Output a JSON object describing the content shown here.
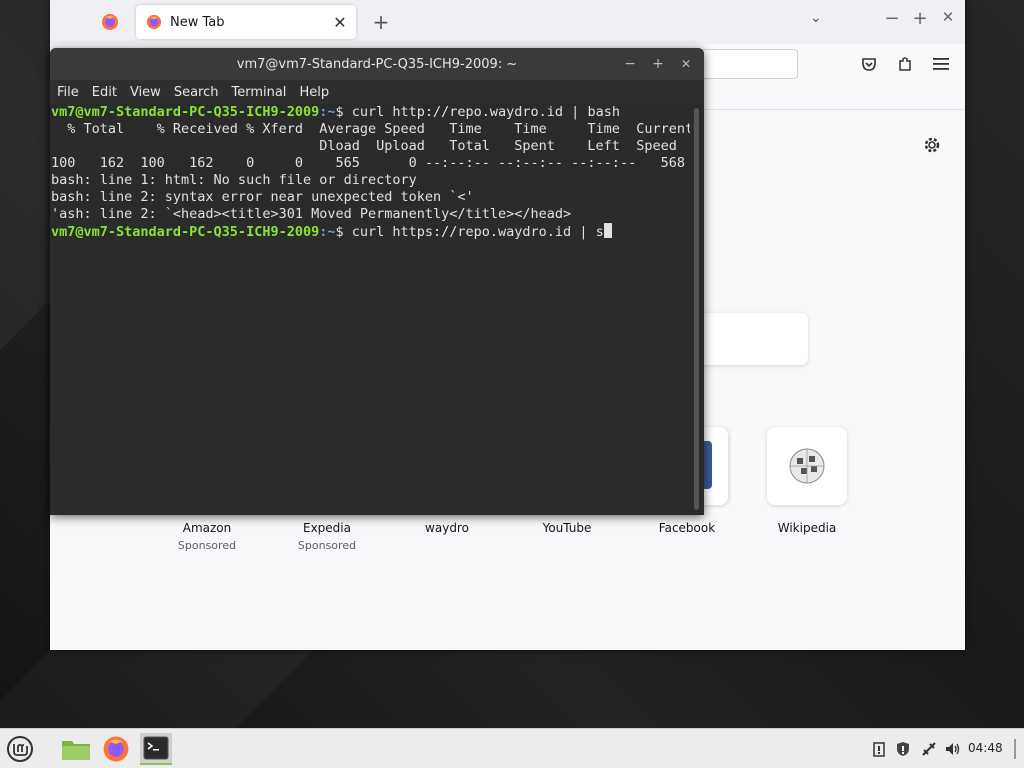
{
  "firefox": {
    "tab_title": "New Tab",
    "tab_close": "✕",
    "new_tab": "+",
    "list_all_tabs": "⌄",
    "minimize": "−",
    "maximize": "+",
    "close": "✕",
    "shortcuts": [
      {
        "name": "Amazon",
        "sponsored": "Sponsored"
      },
      {
        "name": "Expedia",
        "sponsored": "Sponsored"
      },
      {
        "name": "waydro",
        "sponsored": ""
      },
      {
        "name": "YouTube",
        "sponsored": ""
      },
      {
        "name": "Facebook",
        "sponsored": ""
      },
      {
        "name": "Wikipedia",
        "sponsored": ""
      }
    ]
  },
  "terminal": {
    "title": "vm7@vm7-Standard-PC-Q35-ICH9-2009: ~",
    "minimize": "−",
    "maximize": "+",
    "close": "✕",
    "menus": [
      "File",
      "Edit",
      "View",
      "Search",
      "Terminal",
      "Help"
    ],
    "prompt_user": "vm7@vm7-Standard-PC-Q35-ICH9-2009",
    "prompt_path": ":~",
    "lines": {
      "cmd1": "$ curl http://repo.waydro.id | bash",
      "hdr1": "  % Total    % Received % Xferd  Average Speed   Time    Time     Time  Current",
      "hdr2": "                                 Dload  Upload   Total   Spent    Left  Speed",
      "prog": "100   162  100   162    0     0    565      0 --:--:-- --:--:-- --:--:--   568",
      "err1": "bash: line 1: html: No such file or directory",
      "err2": "bash: line 2: syntax error near unexpected token `<'",
      "err3": "'ash: line 2: `<head><title>301 Moved Permanently</title></head>",
      "cmd2": "$ curl https://repo.waydro.id | s"
    }
  },
  "taskbar": {
    "clock": "04:48"
  },
  "colors": {
    "prompt_user": "#8ae234",
    "prompt_path": "#729fcf",
    "terminal_bg": "#2b2b2b"
  }
}
